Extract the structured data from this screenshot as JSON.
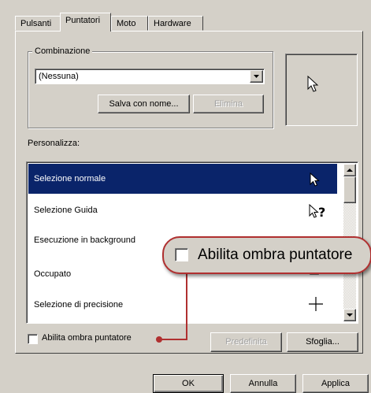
{
  "tabs": [
    {
      "label": "Pulsanti"
    },
    {
      "label": "Puntatori"
    },
    {
      "label": "Moto"
    },
    {
      "label": "Hardware"
    }
  ],
  "scheme": {
    "group_label": "Combinazione",
    "selected": "(Nessuna)",
    "save_as_label": "Salva con nome...",
    "delete_label": "Elimina"
  },
  "customize": {
    "label": "Personalizza:",
    "items": [
      {
        "label": "Selezione normale",
        "icon": "arrow-cursor-icon",
        "selected": true
      },
      {
        "label": "Selezione Guida",
        "icon": "help-cursor-icon"
      },
      {
        "label": "Esecuzione in background",
        "icon": "working-cursor-icon"
      },
      {
        "label": "Occupato",
        "icon": "hourglass-cursor-icon"
      },
      {
        "label": "Selezione di precisione",
        "icon": "crosshair-cursor-icon"
      }
    ]
  },
  "shadow_checkbox": {
    "label": "Abilita ombra puntatore",
    "checked": false
  },
  "callout": {
    "label": "Abilita ombra puntatore"
  },
  "buttons": {
    "default_label": "Predefinita",
    "browse_label": "Sfoglia...",
    "ok_label": "OK",
    "cancel_label": "Annulla",
    "apply_label": "Applica"
  },
  "colors": {
    "selection": "#0a246a",
    "callout_border": "#b03030",
    "face": "#d4d0c8"
  }
}
